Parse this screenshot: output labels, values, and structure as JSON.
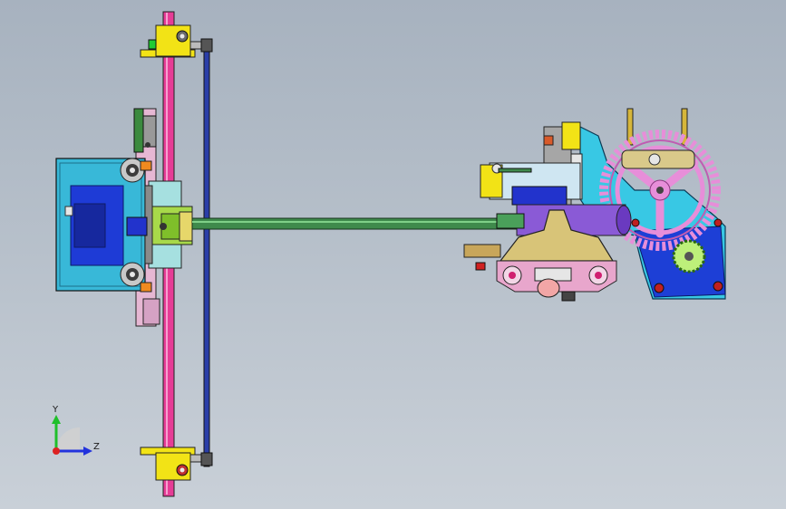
{
  "triad": {
    "y_label": "Y",
    "z_label": "Z"
  },
  "colors": {
    "background_top": "#a7b2bf",
    "background_bottom": "#c9d0d8",
    "rail": "#e63c96",
    "tie_rod": "#2a3ea8",
    "shaft": "#3f8a4c",
    "gear": "#e78ed9",
    "motor_housing": "#38b8d8",
    "bracket": "#f2e316",
    "saddle": "#d8c478",
    "axis_y": "#1fbf2a",
    "axis_z": "#2233dd",
    "axis_x": "#dd2222"
  }
}
